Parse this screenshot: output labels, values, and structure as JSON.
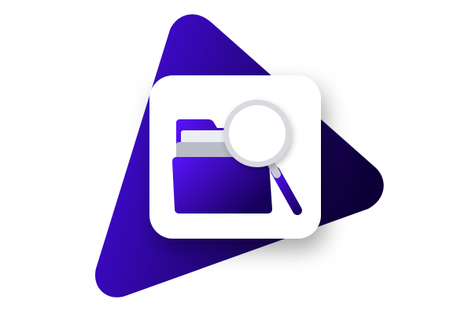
{
  "logo": {
    "name": "file-finder-app-logo",
    "icons": [
      "folder-icon",
      "magnifying-glass-icon"
    ],
    "colors": {
      "background": "#ffffff",
      "triangle_start": "#4a0cf0",
      "triangle_end": "#0d0038",
      "tile": "#ffffff",
      "folder_start": "#5a12ff",
      "folder_end": "#16005a",
      "paper_front": "#b9bbc7",
      "paper_back": "#eceef3",
      "glass_rim": "#d9dadf",
      "glass_lens": "#ffffff",
      "handle_start": "#4e10f5",
      "handle_end": "#1c0066"
    }
  }
}
